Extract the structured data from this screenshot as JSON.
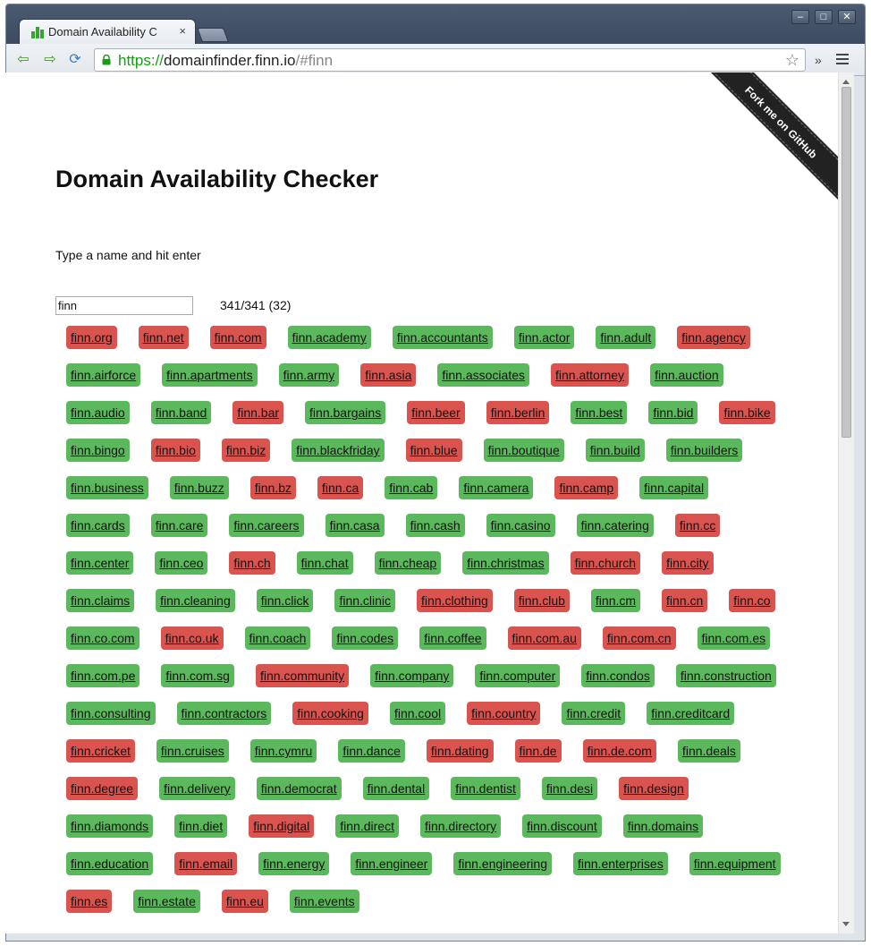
{
  "browser": {
    "tab_title": "Domain Availability C",
    "tab_close": "×",
    "url_scheme": "https://",
    "url_host": "domainfinder.finn.io",
    "url_hash": "/#finn",
    "extensions_chevron": "»",
    "icons": [
      "back-icon",
      "forward-icon",
      "reload-icon",
      "lock-icon",
      "star-icon",
      "menu-icon"
    ]
  },
  "ribbon": {
    "label": "Fork me on GitHub"
  },
  "page": {
    "title": "Domain Availability Checker",
    "instruction": "Type a name and hit enter",
    "input_value": "finn",
    "counter": "341/341 (32)"
  },
  "colors": {
    "available": "#5cb85c",
    "taken": "#d9534f"
  },
  "domains": [
    {
      "name": "finn.org",
      "available": false
    },
    {
      "name": "finn.net",
      "available": false
    },
    {
      "name": "finn.com",
      "available": false
    },
    {
      "name": "finn.academy",
      "available": true
    },
    {
      "name": "finn.accountants",
      "available": true
    },
    {
      "name": "finn.actor",
      "available": true
    },
    {
      "name": "finn.adult",
      "available": true
    },
    {
      "name": "finn.agency",
      "available": false
    },
    {
      "name": "finn.airforce",
      "available": true
    },
    {
      "name": "finn.apartments",
      "available": true
    },
    {
      "name": "finn.army",
      "available": true
    },
    {
      "name": "finn.asia",
      "available": false
    },
    {
      "name": "finn.associates",
      "available": true
    },
    {
      "name": "finn.attorney",
      "available": false
    },
    {
      "name": "finn.auction",
      "available": true
    },
    {
      "name": "finn.audio",
      "available": true
    },
    {
      "name": "finn.band",
      "available": true
    },
    {
      "name": "finn.bar",
      "available": false
    },
    {
      "name": "finn.bargains",
      "available": true
    },
    {
      "name": "finn.beer",
      "available": false
    },
    {
      "name": "finn.berlin",
      "available": false
    },
    {
      "name": "finn.best",
      "available": true
    },
    {
      "name": "finn.bid",
      "available": true
    },
    {
      "name": "finn.bike",
      "available": false
    },
    {
      "name": "finn.bingo",
      "available": true
    },
    {
      "name": "finn.bio",
      "available": false
    },
    {
      "name": "finn.biz",
      "available": false
    },
    {
      "name": "finn.blackfriday",
      "available": true
    },
    {
      "name": "finn.blue",
      "available": false
    },
    {
      "name": "finn.boutique",
      "available": true
    },
    {
      "name": "finn.build",
      "available": true
    },
    {
      "name": "finn.builders",
      "available": true
    },
    {
      "name": "finn.business",
      "available": true
    },
    {
      "name": "finn.buzz",
      "available": true
    },
    {
      "name": "finn.bz",
      "available": false
    },
    {
      "name": "finn.ca",
      "available": false
    },
    {
      "name": "finn.cab",
      "available": true
    },
    {
      "name": "finn.camera",
      "available": true
    },
    {
      "name": "finn.camp",
      "available": false
    },
    {
      "name": "finn.capital",
      "available": true
    },
    {
      "name": "finn.cards",
      "available": true
    },
    {
      "name": "finn.care",
      "available": true
    },
    {
      "name": "finn.careers",
      "available": true
    },
    {
      "name": "finn.casa",
      "available": true
    },
    {
      "name": "finn.cash",
      "available": true
    },
    {
      "name": "finn.casino",
      "available": true
    },
    {
      "name": "finn.catering",
      "available": true
    },
    {
      "name": "finn.cc",
      "available": false
    },
    {
      "name": "finn.center",
      "available": true
    },
    {
      "name": "finn.ceo",
      "available": true
    },
    {
      "name": "finn.ch",
      "available": false
    },
    {
      "name": "finn.chat",
      "available": true
    },
    {
      "name": "finn.cheap",
      "available": true
    },
    {
      "name": "finn.christmas",
      "available": true
    },
    {
      "name": "finn.church",
      "available": false
    },
    {
      "name": "finn.city",
      "available": false
    },
    {
      "name": "finn.claims",
      "available": true
    },
    {
      "name": "finn.cleaning",
      "available": true
    },
    {
      "name": "finn.click",
      "available": true
    },
    {
      "name": "finn.clinic",
      "available": true
    },
    {
      "name": "finn.clothing",
      "available": false
    },
    {
      "name": "finn.club",
      "available": false
    },
    {
      "name": "finn.cm",
      "available": true
    },
    {
      "name": "finn.cn",
      "available": false
    },
    {
      "name": "finn.co",
      "available": false
    },
    {
      "name": "finn.co.com",
      "available": true
    },
    {
      "name": "finn.co.uk",
      "available": false
    },
    {
      "name": "finn.coach",
      "available": true
    },
    {
      "name": "finn.codes",
      "available": true
    },
    {
      "name": "finn.coffee",
      "available": true
    },
    {
      "name": "finn.com.au",
      "available": false
    },
    {
      "name": "finn.com.cn",
      "available": false
    },
    {
      "name": "finn.com.es",
      "available": true
    },
    {
      "name": "finn.com.pe",
      "available": true
    },
    {
      "name": "finn.com.sg",
      "available": true
    },
    {
      "name": "finn.community",
      "available": false
    },
    {
      "name": "finn.company",
      "available": true
    },
    {
      "name": "finn.computer",
      "available": true
    },
    {
      "name": "finn.condos",
      "available": true
    },
    {
      "name": "finn.construction",
      "available": true
    },
    {
      "name": "finn.consulting",
      "available": true
    },
    {
      "name": "finn.contractors",
      "available": true
    },
    {
      "name": "finn.cooking",
      "available": false
    },
    {
      "name": "finn.cool",
      "available": true
    },
    {
      "name": "finn.country",
      "available": false
    },
    {
      "name": "finn.credit",
      "available": true
    },
    {
      "name": "finn.creditcard",
      "available": true
    },
    {
      "name": "finn.cricket",
      "available": false
    },
    {
      "name": "finn.cruises",
      "available": true
    },
    {
      "name": "finn.cymru",
      "available": true
    },
    {
      "name": "finn.dance",
      "available": true
    },
    {
      "name": "finn.dating",
      "available": false
    },
    {
      "name": "finn.de",
      "available": false
    },
    {
      "name": "finn.de.com",
      "available": false
    },
    {
      "name": "finn.deals",
      "available": true
    },
    {
      "name": "finn.degree",
      "available": false
    },
    {
      "name": "finn.delivery",
      "available": true
    },
    {
      "name": "finn.democrat",
      "available": true
    },
    {
      "name": "finn.dental",
      "available": true
    },
    {
      "name": "finn.dentist",
      "available": true
    },
    {
      "name": "finn.desi",
      "available": true
    },
    {
      "name": "finn.design",
      "available": false
    },
    {
      "name": "finn.diamonds",
      "available": true
    },
    {
      "name": "finn.diet",
      "available": true
    },
    {
      "name": "finn.digital",
      "available": false
    },
    {
      "name": "finn.direct",
      "available": true
    },
    {
      "name": "finn.directory",
      "available": true
    },
    {
      "name": "finn.discount",
      "available": true
    },
    {
      "name": "finn.domains",
      "available": true
    },
    {
      "name": "finn.education",
      "available": true
    },
    {
      "name": "finn.email",
      "available": false
    },
    {
      "name": "finn.energy",
      "available": true
    },
    {
      "name": "finn.engineer",
      "available": true
    },
    {
      "name": "finn.engineering",
      "available": true
    },
    {
      "name": "finn.enterprises",
      "available": true
    },
    {
      "name": "finn.equipment",
      "available": true
    },
    {
      "name": "finn.es",
      "available": false
    },
    {
      "name": "finn.estate",
      "available": true
    },
    {
      "name": "finn.eu",
      "available": false
    },
    {
      "name": "finn.events",
      "available": true
    }
  ]
}
